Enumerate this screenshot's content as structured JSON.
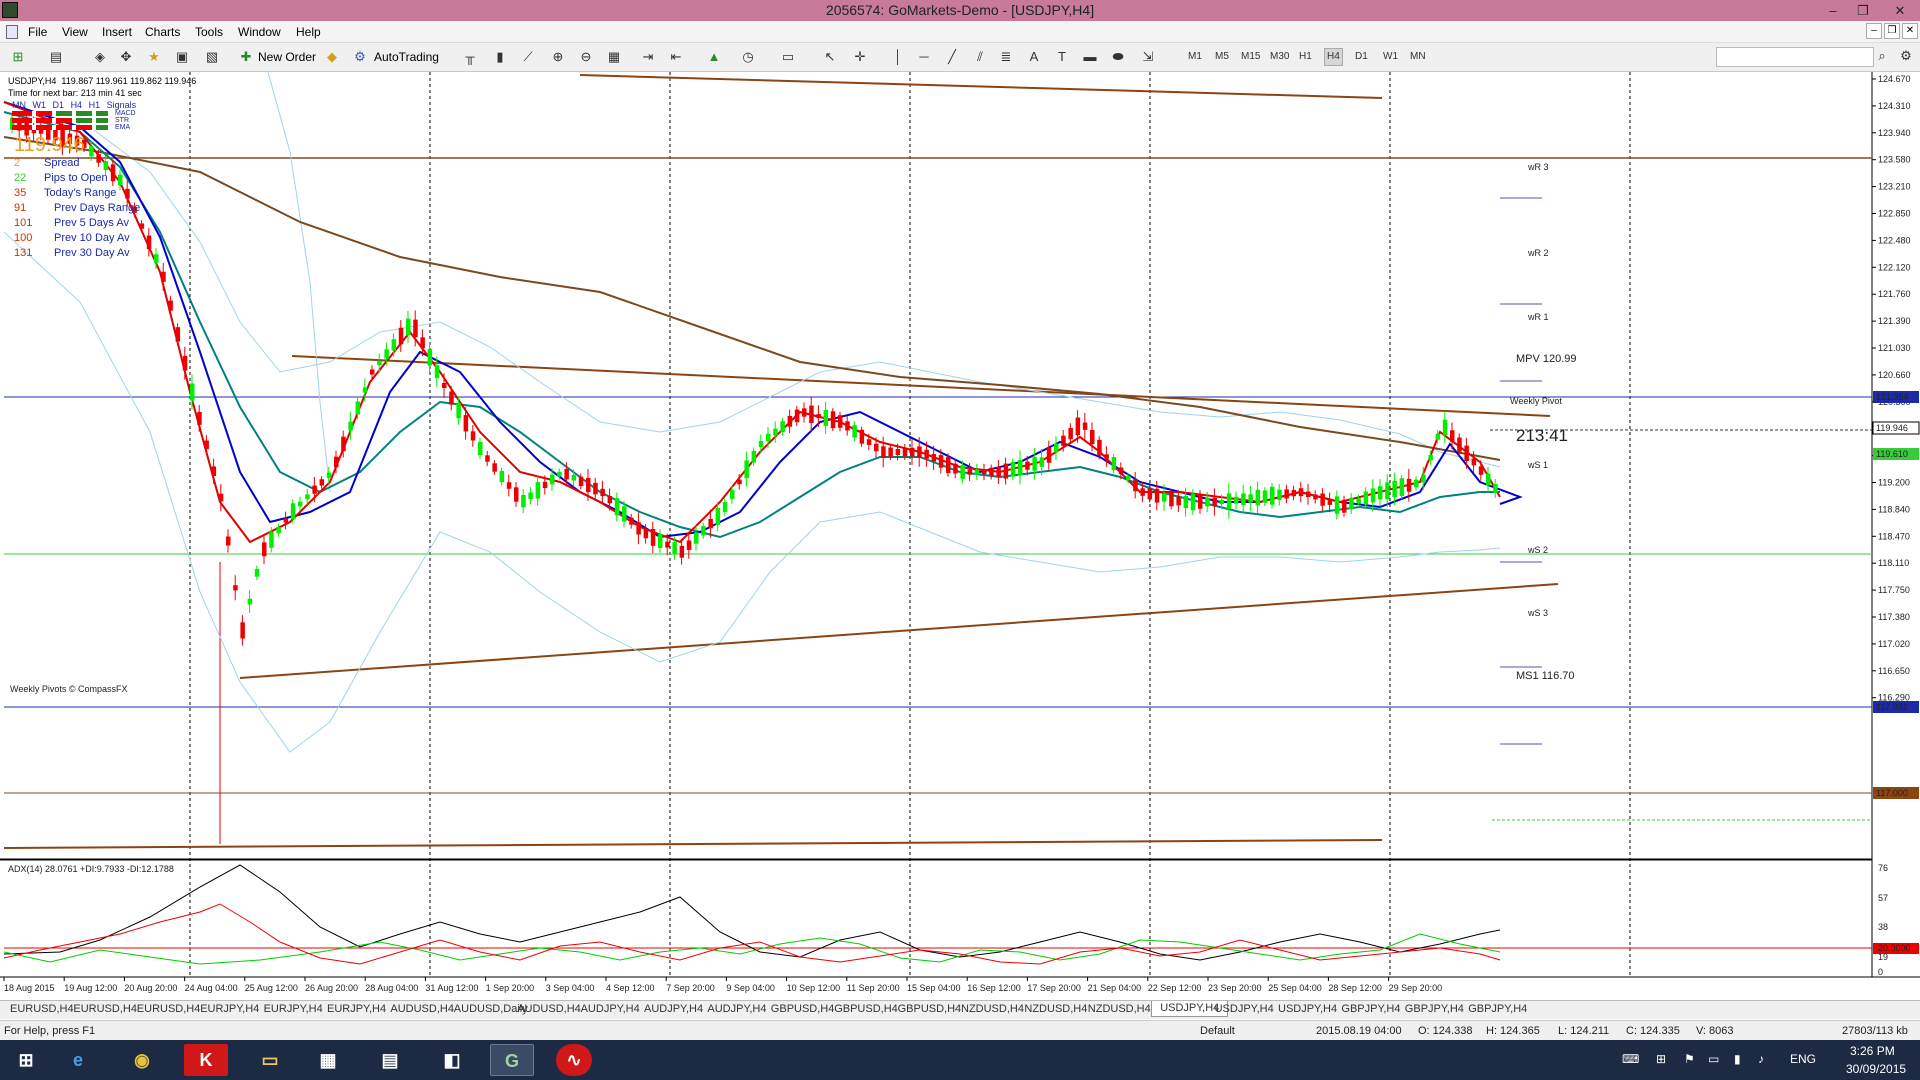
{
  "window": {
    "title": "2056574: GoMarkets-Demo - [USDJPY,H4]",
    "controls": [
      "–",
      "❐",
      "✕"
    ]
  },
  "menu": [
    "File",
    "View",
    "Insert",
    "Charts",
    "Tools",
    "Window",
    "Help"
  ],
  "toolbar": {
    "new_order": "New Order",
    "autotrading": "AutoTrading",
    "timeframes": [
      "M1",
      "M5",
      "M15",
      "M30",
      "H1",
      "H4",
      "D1",
      "W1",
      "MN"
    ],
    "active_tf": "H4"
  },
  "chart": {
    "header": "USDJPY,H4  119.867 119.961 119.862 119.946",
    "timer_line": "Time for next bar: 213 min 41 sec",
    "signals_row": [
      "MN",
      "W1",
      "D1",
      "H4",
      "H1",
      "Signals"
    ],
    "signal_labels": [
      "MACD",
      "STR",
      "EMA"
    ],
    "big_price": "119.946",
    "stats": [
      {
        "n": "2",
        "label": "Spread"
      },
      {
        "n": "22",
        "label": "Pips to Open"
      },
      {
        "n": "35",
        "label": "Today's Range"
      },
      {
        "n": "91",
        "label": "Prev Days Range"
      },
      {
        "n": "101",
        "label": "Prev 5 Days Av"
      },
      {
        "n": "100",
        "label": "Prev 10 Day Av"
      },
      {
        "n": "131",
        "label": "Prev 30 Day Av"
      }
    ],
    "watermark": "Weekly Pivots © CompassFX",
    "pivots": {
      "wr3": "wR 3",
      "wr2": "wR 2",
      "wr1": "wR 1",
      "mpv": "MPV   120.99",
      "weekly_pivot": "Weekly Pivot",
      "ws1": "wS 1",
      "ws2": "wS 2",
      "ws3": "wS 3",
      "ms1": "MS1   116.70"
    },
    "countdown": "213:41",
    "price_axis": [
      "124.670",
      "124.310",
      "123.940",
      "123.580",
      "123.210",
      "122.850",
      "122.480",
      "122.120",
      "121.760",
      "121.390",
      "121.030",
      "120.660",
      "120.300",
      "119.930",
      "119.570",
      "119.200",
      "118.840",
      "118.470",
      "118.110",
      "117.750",
      "117.380",
      "117.020",
      "116.650",
      "116.290"
    ],
    "price_tags": {
      "blue_high": "121.354",
      "current": "119.946",
      "green": "119.610",
      "blue_low": "117.932",
      "brown": "117.000"
    },
    "adx_label": "ADX(14) 28.0761 +DI:9.7933 -DI:12.1788",
    "adx_axis": [
      "76",
      "57",
      "38",
      "20.0000",
      "19",
      "0"
    ],
    "time_axis": [
      "18 Aug 2015",
      "19 Aug 12:00",
      "20 Aug 20:00",
      "24 Aug 04:00",
      "25 Aug 12:00",
      "26 Aug 20:00",
      "28 Aug 04:00",
      "31 Aug 12:00",
      "1 Sep 20:00",
      "3 Sep 04:00",
      "4 Sep 12:00",
      "7 Sep 20:00",
      "9 Sep 04:00",
      "10 Sep 12:00",
      "11 Sep 20:00",
      "15 Sep 04:00",
      "16 Sep 12:00",
      "17 Sep 20:00",
      "21 Sep 04:00",
      "22 Sep 12:00",
      "23 Sep 20:00",
      "25 Sep 04:00",
      "28 Sep 12:00",
      "29 Sep 20:00"
    ],
    "colors": {
      "bull": "#00ee00",
      "bear": "#ee0000",
      "ema_fast": "#e00000",
      "ema_mid": "#0000cc",
      "ema_slow": "#008080",
      "trendline": "#8b4513",
      "ma200": "#7a4a1e",
      "bands": "#9fd4ea",
      "blue_level": "#1c2aa8",
      "green_level": "#3acb3a",
      "pivot": "#6a4aa8"
    }
  },
  "tabs": [
    "EURUSD,H4",
    "EURUSD,H4",
    "EURUSD,H4",
    "EURJPY,H4",
    "EURJPY,H4",
    "EURJPY,H4",
    "AUDUSD,H4",
    "AUDUSD,Daily",
    "AUDUSD,H4",
    "AUDJPY,H4",
    "AUDJPY,H4",
    "AUDJPY,H4",
    "GBPUSD,H4",
    "GBPUSD,H4",
    "GBPUSD,H4",
    "NZDUSD,H4",
    "NZDUSD,H4",
    "NZDUSD,H4",
    "USDJPY,H4",
    "USDJPY,H4",
    "USDJPY,H4",
    "GBPJPY,H4",
    "GBPJPY,H4",
    "GBPJPY,H4"
  ],
  "active_tab_index": 18,
  "status": {
    "help": "For Help, press F1",
    "profile": "Default",
    "datetime": "2015.08.19 04:00",
    "open": "O: 124.338",
    "high": "H: 124.365",
    "low": "L: 124.211",
    "close": "C: 124.335",
    "volume": "V: 8063",
    "traffic": "27803/113 kb"
  },
  "taskbar": {
    "lang": "ENG",
    "time": "3:26 PM",
    "date": "30/09/2015"
  }
}
